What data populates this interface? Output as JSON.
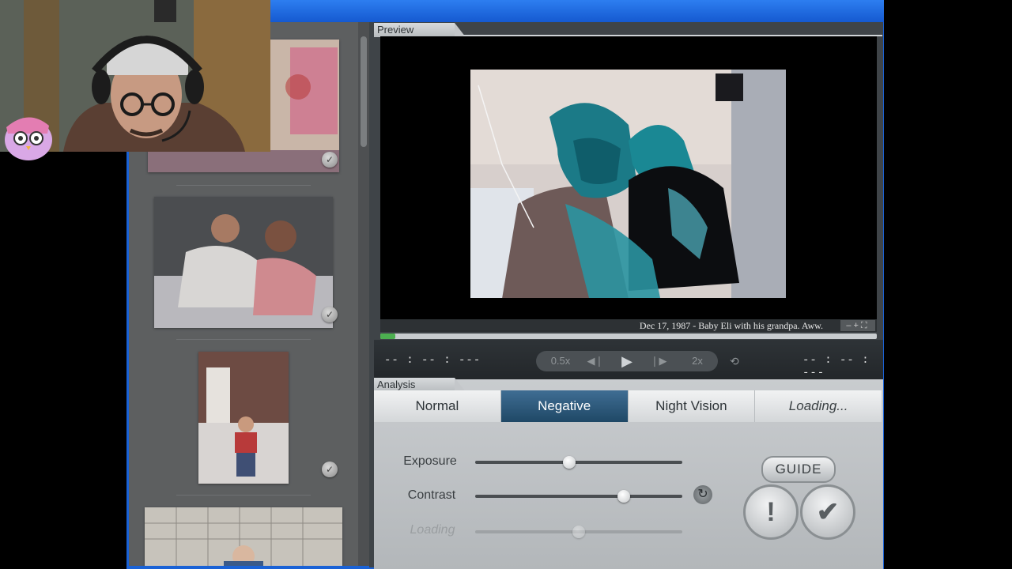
{
  "preview": {
    "tab_label": "Preview",
    "caption": "Dec 17, 1987 - Baby Eli with his grandpa. Aww.",
    "zoom_symbols": "–+⛶",
    "progress": 0.03
  },
  "transport": {
    "time_left": "-- : -- : ---",
    "time_right": "-- : -- : ---",
    "speed_slow": "0.5x",
    "speed_fast": "2x"
  },
  "analysis": {
    "tab_label": "Analysis",
    "modes": [
      "Normal",
      "Negative",
      "Night Vision",
      "Loading..."
    ],
    "active_mode": "Negative",
    "sliders": [
      {
        "label": "Exposure",
        "value": 0.45
      },
      {
        "label": "Contrast",
        "value": 0.73
      },
      {
        "label": "Loading",
        "value": 0.5
      }
    ],
    "guide_label": "GUIDE"
  },
  "icons": {
    "step_back": "step-back-icon",
    "play": "play-icon",
    "step_forward": "step-forward-icon",
    "loop": "loop-icon",
    "reset": "reset-icon",
    "report": "exclamation-icon",
    "confirm": "checkmark-icon"
  },
  "colors": {
    "active_tab": "#1f4866",
    "window_blue": "#1a62d6",
    "progress_green": "#4caf50"
  }
}
